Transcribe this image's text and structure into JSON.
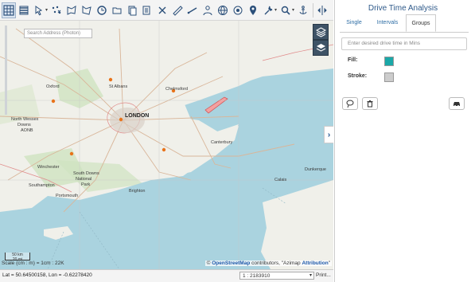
{
  "toolbar": {
    "tools": [
      "grid-icon",
      "layers-stack-icon",
      "pointer-icon",
      "scatter-icon",
      "polygon-icon",
      "polygon-select-icon",
      "refresh-circle-icon",
      "folder-icon",
      "copy-icon",
      "close-x-icon",
      "ruler-icon",
      "measure-icon",
      "person-icon",
      "globe-icon",
      "target-icon",
      "map-pin-icon",
      "wrench-icon",
      "magnify-icon",
      "anchor-icon",
      "horizontal-resize-icon"
    ]
  },
  "map": {
    "search_placeholder": "Search Address (Photon)",
    "scale_bar_top": "50 km",
    "scale_bar_bottom": "20 mi",
    "scale_text": "Scale (cm : m) = 1cm : 22K",
    "attribution_prefix": "© ",
    "attribution_osm": "OpenStreetMap",
    "attribution_middle": " contributors, \"Azimap ",
    "attribution_link": "Attribution",
    "attribution_suffix": "\"",
    "cities": {
      "oxford": "Oxford",
      "st_albans": "St Albans",
      "chelmsford": "Chelmsford",
      "london": "LONDON",
      "canterbury": "Canterbury",
      "north_wessex": "North Wessex",
      "downs": "Downs",
      "aonb": "AONB",
      "winchester": "Winchester",
      "south_downs": "South Downs",
      "national": "National",
      "park": "Park",
      "southampton": "Southampton",
      "portsmouth": "Portsmouth",
      "brighton": "Brighton",
      "calais": "Calais",
      "dunkerque": "Dunkerque"
    },
    "markers": [
      {
        "lon": -0.33,
        "lat": 51.76
      },
      {
        "lon": 0.47,
        "lat": 51.74
      },
      {
        "lon": -1.26,
        "lat": 51.72
      },
      {
        "lon": -0.12,
        "lat": 51.51
      },
      {
        "lon": 0.27,
        "lat": 51.13
      },
      {
        "lon": -1.04,
        "lat": 51.27
      }
    ]
  },
  "status": {
    "coords": "Lat = 50.64500158, Lon = -0.62278420",
    "scale_value": "1 : 2183910",
    "print_label": "Print..."
  },
  "panel": {
    "title": "Drive Time Analysis",
    "tabs": [
      "Single",
      "Intervals",
      "Groups"
    ],
    "active_tab": "Groups",
    "drive_placeholder": "Enter desired drive time in Mins",
    "fill_label": "Fill:",
    "stroke_label": "Stroke:",
    "fill_color": "#1aa8a8",
    "stroke_color": "#cccccc"
  }
}
